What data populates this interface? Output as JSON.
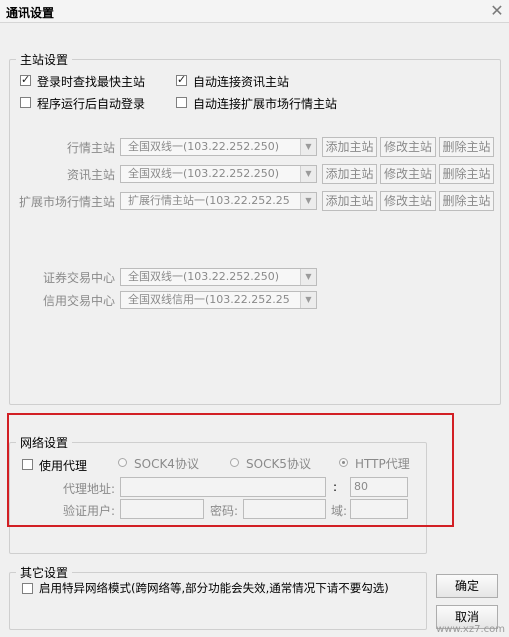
{
  "window": {
    "title": "通讯设置",
    "close_icon": "close-icon"
  },
  "master": {
    "legend": "主站设置",
    "options": [
      {
        "label": "登录时查找最快主站",
        "checked": true
      },
      {
        "label": "自动连接资讯主站",
        "checked": true
      },
      {
        "label": "程序运行后自动登录",
        "checked": false
      },
      {
        "label": "自动连接扩展市场行情主站",
        "checked": false
      }
    ],
    "rows": [
      {
        "label": "行情主站",
        "value": "全国双线一(103.22.252.250)",
        "add": "添加主站",
        "edit": "修改主站",
        "del": "删除主站"
      },
      {
        "label": "资讯主站",
        "value": "全国双线一(103.22.252.250)",
        "add": "添加主站",
        "edit": "修改主站",
        "del": "删除主站"
      },
      {
        "label": "扩展市场行情主站",
        "value": "扩展行情主站一(103.22.252.25",
        "add": "添加主站",
        "edit": "修改主站",
        "del": "删除主站"
      }
    ],
    "trade": [
      {
        "label": "证券交易中心",
        "value": "全国双线一(103.22.252.250)"
      },
      {
        "label": "信用交易中心",
        "value": "全国双线信用一(103.22.252.25"
      }
    ]
  },
  "network": {
    "legend": "网络设置",
    "use_proxy": {
      "label": "使用代理",
      "checked": false
    },
    "protocols": [
      {
        "label": "SOCK4协议",
        "selected": false
      },
      {
        "label": "SOCK5协议",
        "selected": false
      },
      {
        "label": "HTTP代理",
        "selected": true
      }
    ],
    "address_label": "代理地址:",
    "address_value": "",
    "port_sep": ":",
    "port_value": "80",
    "user_label": "验证用户:",
    "password_label": "密码:",
    "domain_label": "域:"
  },
  "other": {
    "legend": "其它设置",
    "special_mode": {
      "label": "启用特异网络模式(跨网络等,部分功能会失效,通常情况下请不要勾选)",
      "checked": false
    }
  },
  "buttons": {
    "ok": "确定",
    "cancel": "取消"
  },
  "watermark": "www.xz7.com"
}
